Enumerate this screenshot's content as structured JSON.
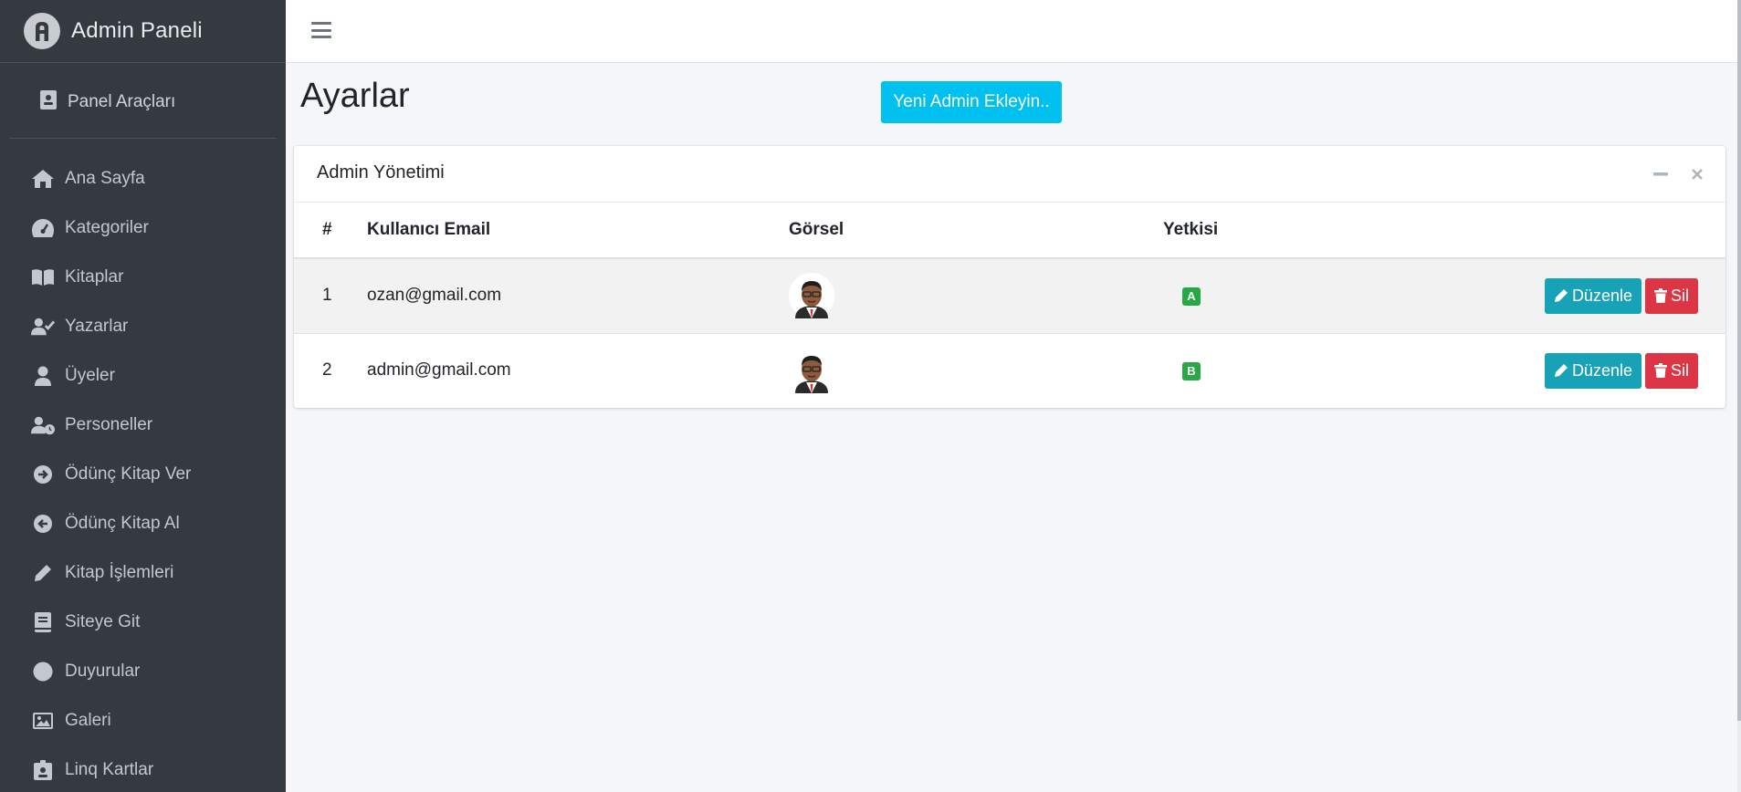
{
  "brand": {
    "title": "Admin Paneli",
    "logo_icon": "admin-logo-icon"
  },
  "panel_tools": {
    "label": "Panel Araçları",
    "icon": "id-card-icon"
  },
  "sidebar": {
    "items": [
      {
        "label": "Ana Sayfa",
        "icon": "home-icon"
      },
      {
        "label": "Kategoriler",
        "icon": "gauge-icon"
      },
      {
        "label": "Kitaplar",
        "icon": "book-open-icon"
      },
      {
        "label": "Yazarlar",
        "icon": "user-check-icon"
      },
      {
        "label": "Üyeler",
        "icon": "user-icon"
      },
      {
        "label": "Personeller",
        "icon": "user-clock-icon"
      },
      {
        "label": "Ödünç Kitap Ver",
        "icon": "arrow-circle-right-icon"
      },
      {
        "label": "Ödünç Kitap Al",
        "icon": "arrow-circle-left-icon"
      },
      {
        "label": "Kitap İşlemleri",
        "icon": "pencil-icon"
      },
      {
        "label": "Siteye Git",
        "icon": "book-icon"
      },
      {
        "label": "Duyurular",
        "icon": "circle-icon"
      },
      {
        "label": "Galeri",
        "icon": "image-icon"
      },
      {
        "label": "Linq Kartlar",
        "icon": "id-badge-icon"
      }
    ]
  },
  "page": {
    "title": "Ayarlar",
    "add_button": "Yeni Admin Ekleyin.."
  },
  "card": {
    "title": "Admin Yönetimi",
    "columns": {
      "index": "#",
      "email": "Kullanıcı Email",
      "image": "Görsel",
      "role": "Yetkisi"
    },
    "rows": [
      {
        "index": "1",
        "email": "ozan@gmail.com",
        "role": "A",
        "edit": "Düzenle",
        "delete": "Sil"
      },
      {
        "index": "2",
        "email": "admin@gmail.com",
        "role": "B",
        "edit": "Düzenle",
        "delete": "Sil"
      }
    ]
  },
  "colors": {
    "sidebar_bg": "#343a40",
    "accent": "#00c0ef",
    "edit_button": "#17a2b8",
    "delete_button": "#dc3545",
    "badge": "#28a745"
  }
}
